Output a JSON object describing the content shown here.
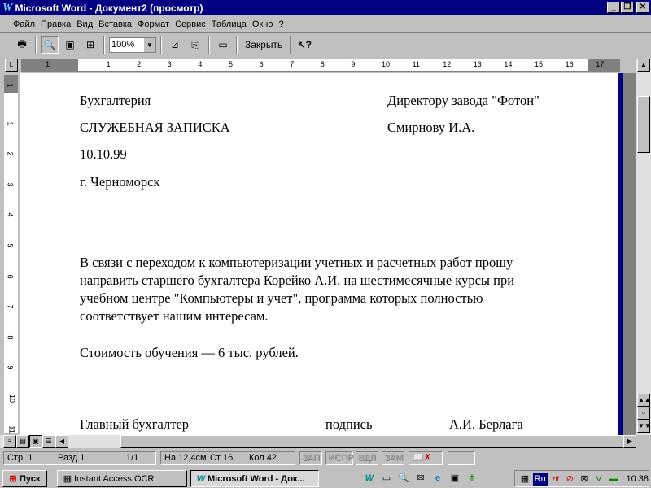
{
  "window": {
    "title": "Microsoft Word - Документ2 (просмотр)",
    "controls": [
      "minimize",
      "restore",
      "close"
    ]
  },
  "menu": [
    "Файл",
    "Правка",
    "Вид",
    "Вставка",
    "Формат",
    "Сервис",
    "Таблица",
    "Окно",
    "?"
  ],
  "toolbar": {
    "zoom": "100%",
    "close_label": "Закрыть",
    "icons": [
      "print-icon",
      "magnifier-icon",
      "one-page-icon",
      "multiple-pages-icon",
      "view-ruler-icon",
      "shrink-to-fit-icon",
      "full-screen-icon",
      "context-help-icon"
    ]
  },
  "ruler": {
    "ticks": [
      "1",
      "1",
      "2",
      "3",
      "4",
      "5",
      "6",
      "7",
      "8",
      "9",
      "10",
      "11",
      "12",
      "13",
      "14",
      "15",
      "16",
      "17"
    ]
  },
  "vruler": {
    "ticks": [
      "1",
      "1",
      "2",
      "3",
      "4",
      "5",
      "6",
      "7",
      "8",
      "9",
      "10",
      "11"
    ]
  },
  "document": {
    "left": [
      "Бухгалтерия",
      "СЛУЖЕБНАЯ ЗАПИСКА",
      "10.10.99",
      "г. Черноморск"
    ],
    "right": [
      "Директору завода \"Фотон\"",
      "Смирнову И.А."
    ],
    "body": [
      "В связи с переходом к компьютеризации учетных и расчетных работ прошу",
      "направить старшего бухгалтера Корейко А.И. на шестимесячные курсы при",
      "учебном центре \"Компьютеры и учет\", программа которых полностью",
      "соответствует нашим интересам."
    ],
    "cost": "Стоимость обучения — 6 тыс. рублей.",
    "signature": {
      "position": "Главный бухгалтер",
      "sign": "подпись",
      "name": "А.И. Берлага"
    }
  },
  "status": {
    "page": "Стр. 1",
    "section": "Разд 1",
    "pages": "1/1",
    "at": "На 12,4см",
    "line": "Ст 16",
    "col": "Кол 42",
    "rec": "ЗАП",
    "trk": "ИСПР",
    "ext": "ВДЛ",
    "ovr": "ЗАМ"
  },
  "taskbar": {
    "start": "Пуск",
    "tasks": [
      "Instant Access OCR",
      "Microsoft Word - Док..."
    ],
    "tray_lang": "Ru",
    "clock": "10:38"
  }
}
